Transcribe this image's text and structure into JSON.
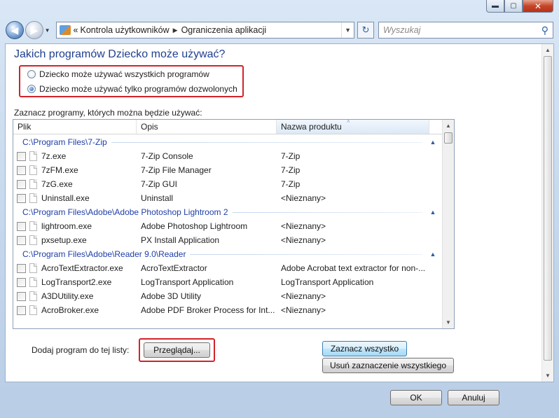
{
  "window": {
    "caption_buttons": {
      "minimize": "▬",
      "maximize": "▢",
      "close": "✕"
    }
  },
  "nav": {
    "back_glyph": "◀",
    "forward_glyph": "▶",
    "dropdown_glyph": "▼",
    "breadcrumb_prefix": "«",
    "breadcrumb": [
      "Kontrola użytkowników",
      "Ograniczenia aplikacji"
    ],
    "breadcrumb_sep": "▶",
    "address_dropdown_glyph": "▼",
    "refresh_glyph": "↻",
    "search_placeholder": "Wyszukaj",
    "search_glyph": "⚲"
  },
  "main": {
    "heading": "Jakich programów Dziecko może używać?",
    "options": [
      {
        "label": "Dziecko może używać wszystkich programów",
        "selected": false
      },
      {
        "label": "Dziecko może używać tylko programów dozwolonych",
        "selected": true
      }
    ],
    "list_label": "Zaznacz programy, których można będzie używać:",
    "columns": [
      "Plik",
      "Opis",
      "Nazwa produktu"
    ],
    "sort_glyph": "˄",
    "collapse_glyph": "▲",
    "groups": [
      {
        "path": "C:\\Program Files\\7-Zip",
        "rows": [
          {
            "file": "7z.exe",
            "desc": "7-Zip Console",
            "product": "7-Zip"
          },
          {
            "file": "7zFM.exe",
            "desc": "7-Zip File Manager",
            "product": "7-Zip"
          },
          {
            "file": "7zG.exe",
            "desc": "7-Zip GUI",
            "product": "7-Zip"
          },
          {
            "file": "Uninstall.exe",
            "desc": "Uninstall",
            "product": "<Nieznany>"
          }
        ]
      },
      {
        "path": "C:\\Program Files\\Adobe\\Adobe Photoshop Lightroom 2",
        "rows": [
          {
            "file": "lightroom.exe",
            "desc": "Adobe Photoshop Lightroom",
            "product": "<Nieznany>"
          },
          {
            "file": "pxsetup.exe",
            "desc": "PX Install Application",
            "product": "<Nieznany>"
          }
        ]
      },
      {
        "path": "C:\\Program Files\\Adobe\\Reader 9.0\\Reader",
        "rows": [
          {
            "file": "AcroTextExtractor.exe",
            "desc": "AcroTextExtractor",
            "product": "Adobe Acrobat text extractor for non-..."
          },
          {
            "file": "LogTransport2.exe",
            "desc": "LogTransport Application",
            "product": "LogTransport Application"
          },
          {
            "file": "A3DUtility.exe",
            "desc": "Adobe 3D Utility",
            "product": "<Nieznany>"
          },
          {
            "file": "AcroBroker.exe",
            "desc": "Adobe PDF Broker Process for Int...",
            "product": "<Nieznany>"
          }
        ]
      }
    ],
    "scroll_up_glyph": "▲",
    "scroll_down_glyph": "▼",
    "add_label": "Dodaj program do tej listy:",
    "browse_button": "Przeglądaj...",
    "select_all_button": "Zaznacz wszystko",
    "deselect_all_button": "Usuń zaznaczenie wszystkiego"
  },
  "footer": {
    "ok_button": "OK",
    "cancel_button": "Anuluj"
  },
  "colors": {
    "heading": "#1f3f8f",
    "highlight_box": "#d2232a",
    "group_header": "#1e3ea8"
  }
}
